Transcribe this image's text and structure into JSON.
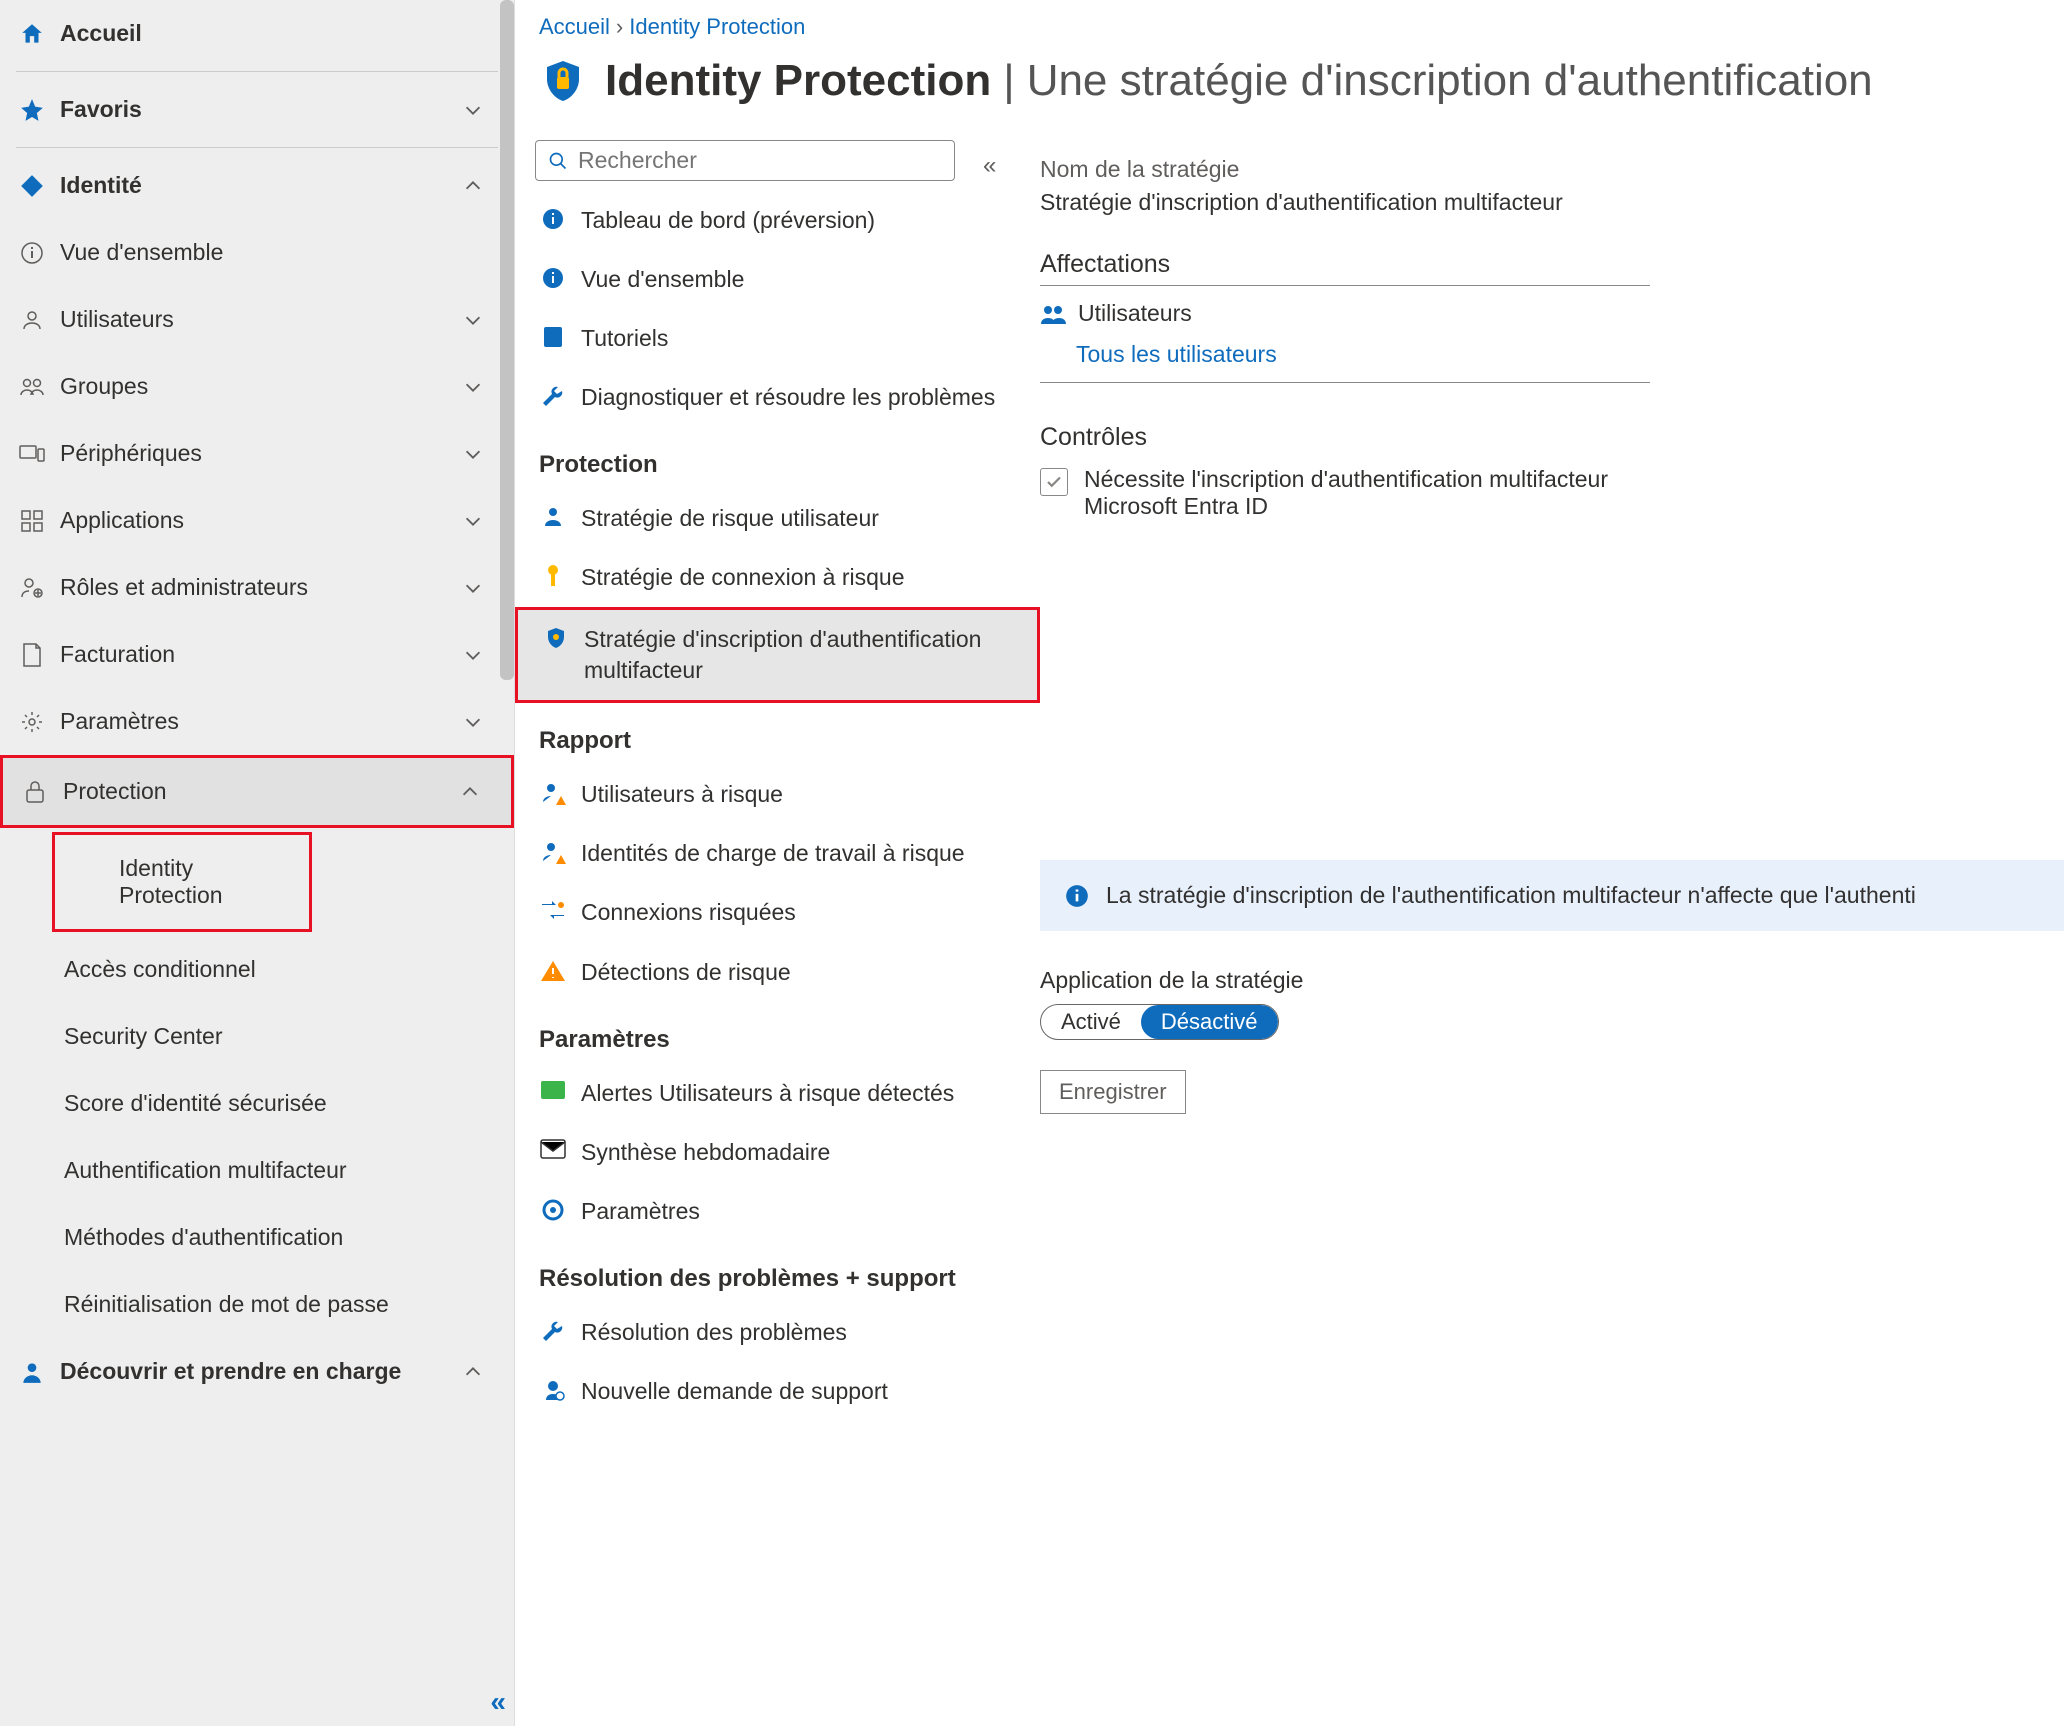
{
  "breadcrumb": {
    "home": "Accueil",
    "current": "Identity Protection"
  },
  "page": {
    "title": "Identity Protection",
    "subtitle": "Une stratégie d'inscription d'authentification"
  },
  "sidebar": {
    "home": "Accueil",
    "favorites": "Favoris",
    "identity": "Identité",
    "overview": "Vue d'ensemble",
    "users": "Utilisateurs",
    "groups": "Groupes",
    "devices": "Périphériques",
    "applications": "Applications",
    "roles": "Rôles et administrateurs",
    "billing": "Facturation",
    "settings": "Paramètres",
    "protection": "Protection",
    "sub_identity_protection": "Identity Protection",
    "sub_conditional_access": "Accès conditionnel",
    "sub_security_center": "Security Center",
    "sub_secure_score": "Score d'identité sécurisée",
    "sub_mfa": "Authentification multifacteur",
    "sub_auth_methods": "Méthodes d'authentification",
    "sub_pwd_reset": "Réinitialisation de mot de passe",
    "learn": "Découvrir et prendre en charge"
  },
  "search": {
    "placeholder": "Rechercher"
  },
  "resmenu": {
    "dashboard": "Tableau de bord (préversion)",
    "overview": "Vue d'ensemble",
    "tutorials": "Tutoriels",
    "diagnose": "Diagnostiquer et résoudre les problèmes",
    "sect_protection": "Protection",
    "user_risk_policy": "Stratégie de risque utilisateur",
    "signin_risk_policy": "Stratégie de connexion à risque",
    "mfa_reg_policy": "Stratégie d'inscription d'authentification multifacteur",
    "sect_report": "Rapport",
    "risky_users": "Utilisateurs à risque",
    "risky_workload": "Identités de charge de travail à risque",
    "risky_signins": "Connexions risquées",
    "risk_detections": "Détections de risque",
    "sect_settings": "Paramètres",
    "alerts": "Alertes Utilisateurs à risque détectés",
    "weekly_digest": "Synthèse hebdomadaire",
    "settings": "Paramètres",
    "sect_troubleshoot": "Résolution des problèmes + support",
    "troubleshoot": "Résolution des problèmes",
    "new_support": "Nouvelle demande de support"
  },
  "main": {
    "policy_name_label": "Nom de la stratégie",
    "policy_name_value": "Stratégie d'inscription d'authentification multifacteur",
    "assignments": "Affectations",
    "users_label": "Utilisateurs",
    "users_value": "Tous les utilisateurs",
    "controls": "Contrôles",
    "control_text": "Nécessite l'inscription d'authentification multifacteur Microsoft Entra ID",
    "info_text": "La stratégie d'inscription de l'authentification multifacteur n'affecte que l'authenti",
    "enforce_label": "Application de la stratégie",
    "enabled": "Activé",
    "disabled": "Désactivé",
    "save": "Enregistrer"
  }
}
